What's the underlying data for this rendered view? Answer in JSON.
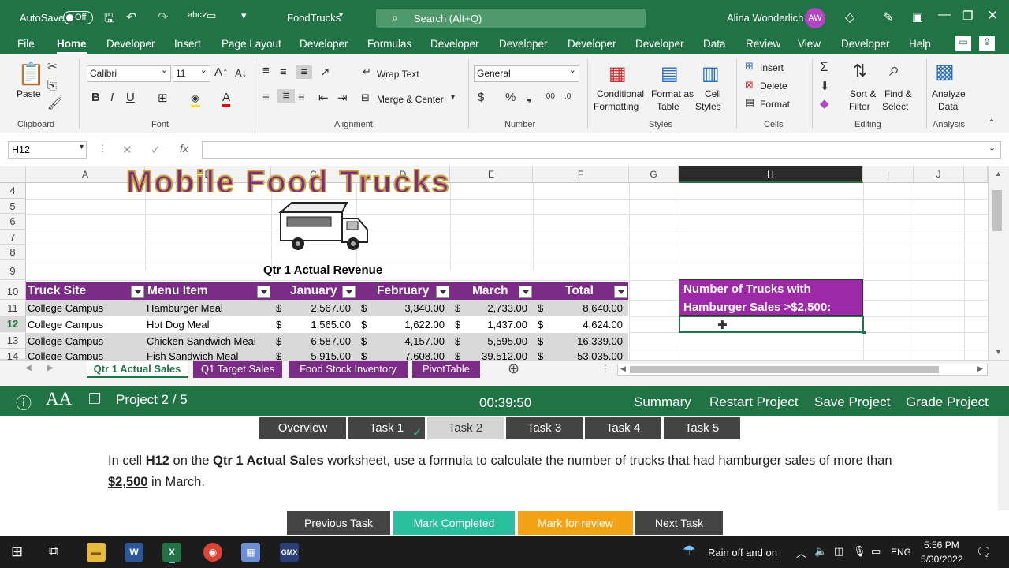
{
  "titlebar": {
    "autosave_label": "AutoSave",
    "autosave_state": "Off",
    "filename": "FoodTrucks",
    "search_placeholder": "Search (Alt+Q)",
    "user_name": "Alina Wonderlich",
    "user_initials": "AW"
  },
  "ribbon_tabs": [
    "File",
    "Home",
    "Developer",
    "Insert",
    "Page Layout",
    "Developer",
    "Formulas",
    "Developer",
    "Developer",
    "Developer",
    "Developer",
    "Data",
    "Review",
    "View",
    "Developer",
    "Help"
  ],
  "ribbon": {
    "paste": "Paste",
    "font_name": "Calibri",
    "font_size": "11",
    "wrap_text": "Wrap Text",
    "merge_center": "Merge & Center",
    "number_format": "General",
    "conditional_formatting_1": "Conditional",
    "conditional_formatting_2": "Formatting",
    "format_as_table_1": "Format as",
    "format_as_table_2": "Table",
    "cell_styles_1": "Cell",
    "cell_styles_2": "Styles",
    "insert": "Insert",
    "delete": "Delete",
    "format": "Format",
    "sort_filter_1": "Sort &",
    "sort_filter_2": "Filter",
    "find_select_1": "Find &",
    "find_select_2": "Select",
    "analyze_1": "Analyze",
    "analyze_2": "Data",
    "groups": {
      "clipboard": "Clipboard",
      "font": "Font",
      "alignment": "Alignment",
      "number": "Number",
      "styles": "Styles",
      "cells": "Cells",
      "editing": "Editing",
      "analysis": "Analysis"
    }
  },
  "formula_bar": {
    "name_box": "H12",
    "formula": ""
  },
  "columns": [
    "A",
    "B",
    "C",
    "D",
    "E",
    "F",
    "G",
    "H",
    "I",
    "J"
  ],
  "rows": [
    "4",
    "5",
    "6",
    "7",
    "8",
    "9",
    "10",
    "11",
    "12",
    "13",
    "14"
  ],
  "sheet": {
    "banner_text": "Mobile Food Trucks",
    "subtitle": "Qtr 1 Actual Revenue",
    "headers": [
      "Truck Site",
      "Menu Item",
      "January",
      "February",
      "March",
      "Total"
    ],
    "data_rows": [
      {
        "site": "College Campus",
        "item": "Hamburger Meal",
        "jan": "2,567.00",
        "feb": "3,340.00",
        "mar": "2,733.00",
        "total": "8,640.00"
      },
      {
        "site": "College Campus",
        "item": "Hot Dog Meal",
        "jan": "1,565.00",
        "feb": "1,622.00",
        "mar": "1,437.00",
        "total": "4,624.00"
      },
      {
        "site": "College Campus",
        "item": "Chicken Sandwich Meal",
        "jan": "6,587.00",
        "feb": "4,157.00",
        "mar": "5,595.00",
        "total": "16,339.00"
      },
      {
        "site": "College Campus",
        "item": "Fish Sandwich Meal",
        "jan": "5,915.00",
        "feb": "7,608.00",
        "mar": "39,512.00",
        "total": "53,035.00"
      }
    ],
    "currency": "$",
    "question_line1": "Number of Trucks with",
    "question_line2": "Hamburger Sales >$2,500:"
  },
  "sheet_tabs": [
    "Qtr 1 Actual Sales",
    "Q1 Target Sales",
    "Food Stock Inventory",
    "PivotTable"
  ],
  "gmetrix": {
    "project": "Project 2 / 5",
    "timer": "00:39:50",
    "summary": "Summary",
    "restart": "Restart Project",
    "save": "Save Project",
    "grade": "Grade Project"
  },
  "task_tabs": [
    "Overview",
    "Task 1",
    "Task 2",
    "Task 3",
    "Task 4",
    "Task 5"
  ],
  "instruction": {
    "p1": "In cell ",
    "b1": "H12",
    "p2": " on the ",
    "b2": "Qtr 1 Actual Sales",
    "p3": " worksheet, use a formula to calculate the number of trucks that had hamburger sales of more than ",
    "b3": "$2,500",
    "p4": " in March."
  },
  "bottom_buttons": {
    "previous": "Previous Task",
    "mark_completed": "Mark Completed",
    "mark_review": "Mark for review",
    "next": "Next Task"
  },
  "taskbar": {
    "weather": "Rain off and on",
    "lang": "ENG",
    "time": "5:56 PM",
    "date": "5/30/2022"
  },
  "colors": {
    "excel_green": "#217346",
    "header_purple": "#7b2c87",
    "box_purple": "#9c2aa7",
    "teal": "#2bbf9e",
    "orange": "#f5a316"
  }
}
